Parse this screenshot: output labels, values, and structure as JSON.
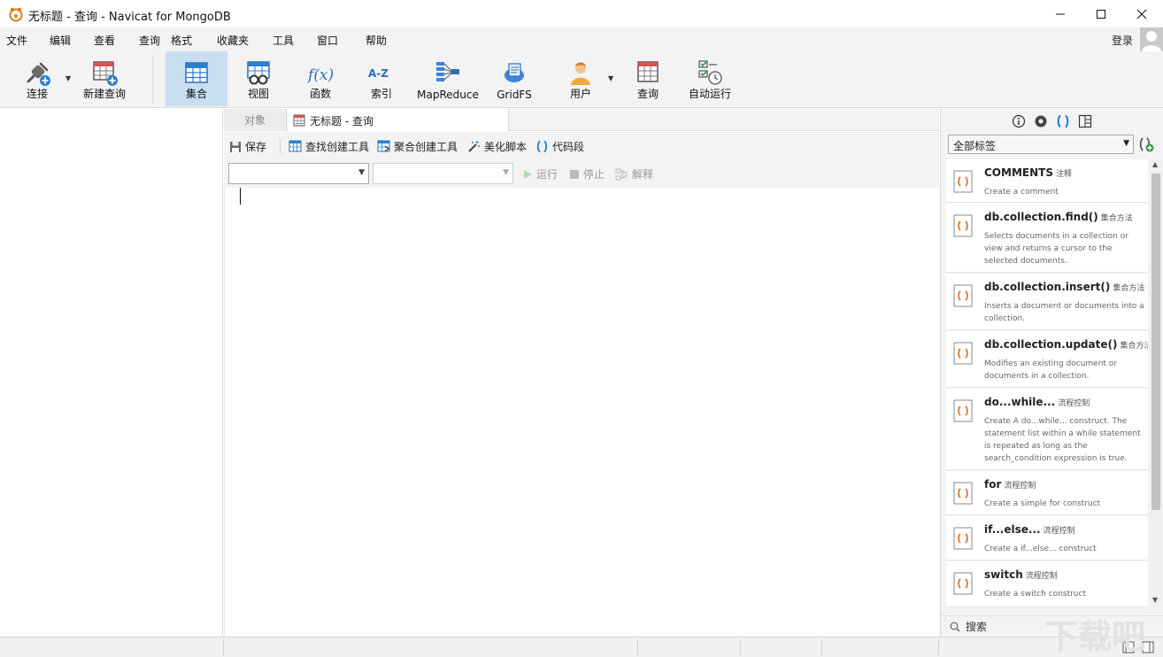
{
  "window": {
    "title": "无标题 - 查询 - Navicat for MongoDB"
  },
  "menu": {
    "items": [
      "文件",
      "编辑",
      "查看",
      "查询",
      "格式",
      "收藏夹",
      "工具",
      "窗口",
      "帮助"
    ],
    "login": "登录"
  },
  "toolbar": {
    "items": [
      {
        "label": "连接",
        "icon": "plug-icon"
      },
      {
        "label": "新建查询",
        "icon": "new-query-icon"
      },
      {
        "label": "集合",
        "icon": "collection-icon",
        "active": true
      },
      {
        "label": "视图",
        "icon": "view-icon"
      },
      {
        "label": "函数",
        "icon": "function-icon"
      },
      {
        "label": "索引",
        "icon": "index-icon"
      },
      {
        "label": "MapReduce",
        "icon": "mapreduce-icon"
      },
      {
        "label": "GridFS",
        "icon": "gridfs-icon"
      },
      {
        "label": "用户",
        "icon": "user-icon"
      },
      {
        "label": "查询",
        "icon": "query-icon"
      },
      {
        "label": "自动运行",
        "icon": "autorun-icon"
      }
    ],
    "function_glyph": "f(x)",
    "index_glyph": "A-Z"
  },
  "tabs": {
    "objects": "对象",
    "query": "无标题 - 查询"
  },
  "query_toolbar": {
    "save": "保存",
    "find_builder": "查找创建工具",
    "aggregate_builder": "聚合创建工具",
    "beautify": "美化脚本",
    "snippet": "代码段"
  },
  "run_row": {
    "run": "运行",
    "stop": "停止",
    "explain": "解释"
  },
  "right_panel": {
    "tag_filter": "全部标签",
    "search": "搜索",
    "snippets": [
      {
        "title": "COMMENTS",
        "tag": "注释",
        "desc": "Create a comment"
      },
      {
        "title": "db.collection.find()",
        "tag": "集合方法",
        "desc": "Selects documents in a collection or view and returns a cursor to the selected documents."
      },
      {
        "title": "db.collection.insert()",
        "tag": "集合方法",
        "desc": "Inserts a document or documents into a collection."
      },
      {
        "title": "db.collection.update()",
        "tag": "集合方法",
        "desc": "Modifies an existing document or documents in a collection."
      },
      {
        "title": "do...while...",
        "tag": "流程控制",
        "desc": "Create A do...while... construct. The statement list within a while statement is repeated as long as the search_condition expression is true."
      },
      {
        "title": "for",
        "tag": "流程控制",
        "desc": "Create a simple for construct"
      },
      {
        "title": "if...else...",
        "tag": "流程控制",
        "desc": "Create a if...else... construct"
      },
      {
        "title": "switch",
        "tag": "流程控制",
        "desc": "Create a switch construct"
      }
    ]
  },
  "watermark": "下载吧",
  "colors": {
    "accent": "#1a7fd4",
    "active_tool_bg": "#c9def3",
    "snippet_icon": "#d9792b"
  }
}
